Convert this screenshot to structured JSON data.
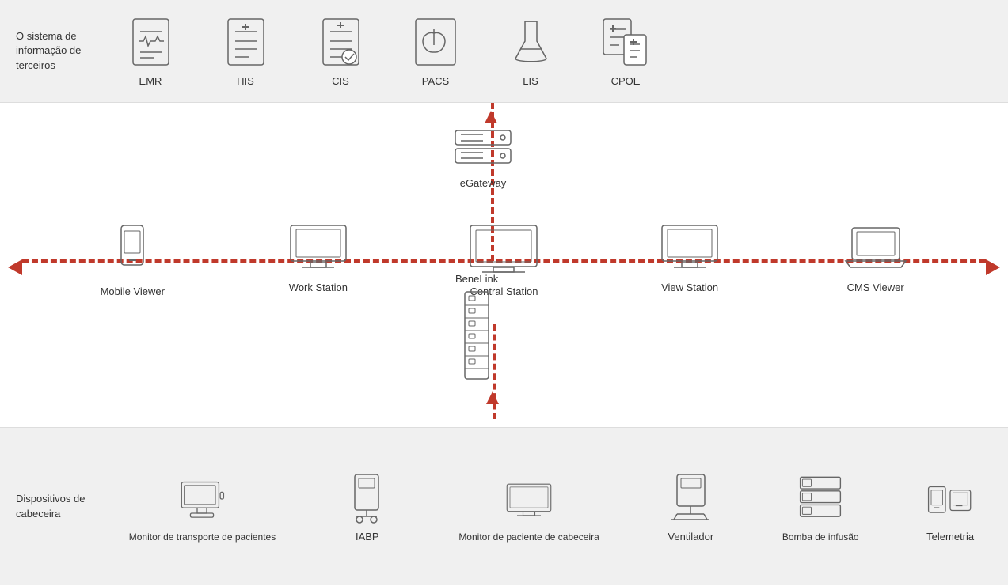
{
  "topSection": {
    "thirdPartyLabel": "O sistema de informação de terceiros",
    "icons": [
      {
        "id": "emr",
        "label": "EMR"
      },
      {
        "id": "his",
        "label": "HIS"
      },
      {
        "id": "cis",
        "label": "CIS"
      },
      {
        "id": "pacs",
        "label": "PACS"
      },
      {
        "id": "lis",
        "label": "LIS"
      },
      {
        "id": "cpoe",
        "label": "CPOE"
      }
    ]
  },
  "middleSection": {
    "egateway": "eGateway",
    "benelink": "BeneLink",
    "nodes": [
      {
        "id": "mobile-viewer",
        "label": "Mobile Viewer"
      },
      {
        "id": "work-station",
        "label": "Work Station"
      },
      {
        "id": "central-station",
        "label": "Central Station"
      },
      {
        "id": "view-station",
        "label": "View Station"
      },
      {
        "id": "cms-viewer",
        "label": "CMS Viewer"
      }
    ]
  },
  "bottomSection": {
    "bedsideLabel": "Dispositivos de cabeceira",
    "icons": [
      {
        "id": "transport-monitor",
        "label": "Monitor de transporte de pacientes"
      },
      {
        "id": "iabp",
        "label": "IABP"
      },
      {
        "id": "bedside-monitor",
        "label": "Monitor de paciente de cabeceira"
      },
      {
        "id": "ventilator",
        "label": "Ventilador"
      },
      {
        "id": "infusion-pump",
        "label": "Bomba de infusão"
      },
      {
        "id": "telemetry",
        "label": "Telemetria"
      }
    ]
  }
}
